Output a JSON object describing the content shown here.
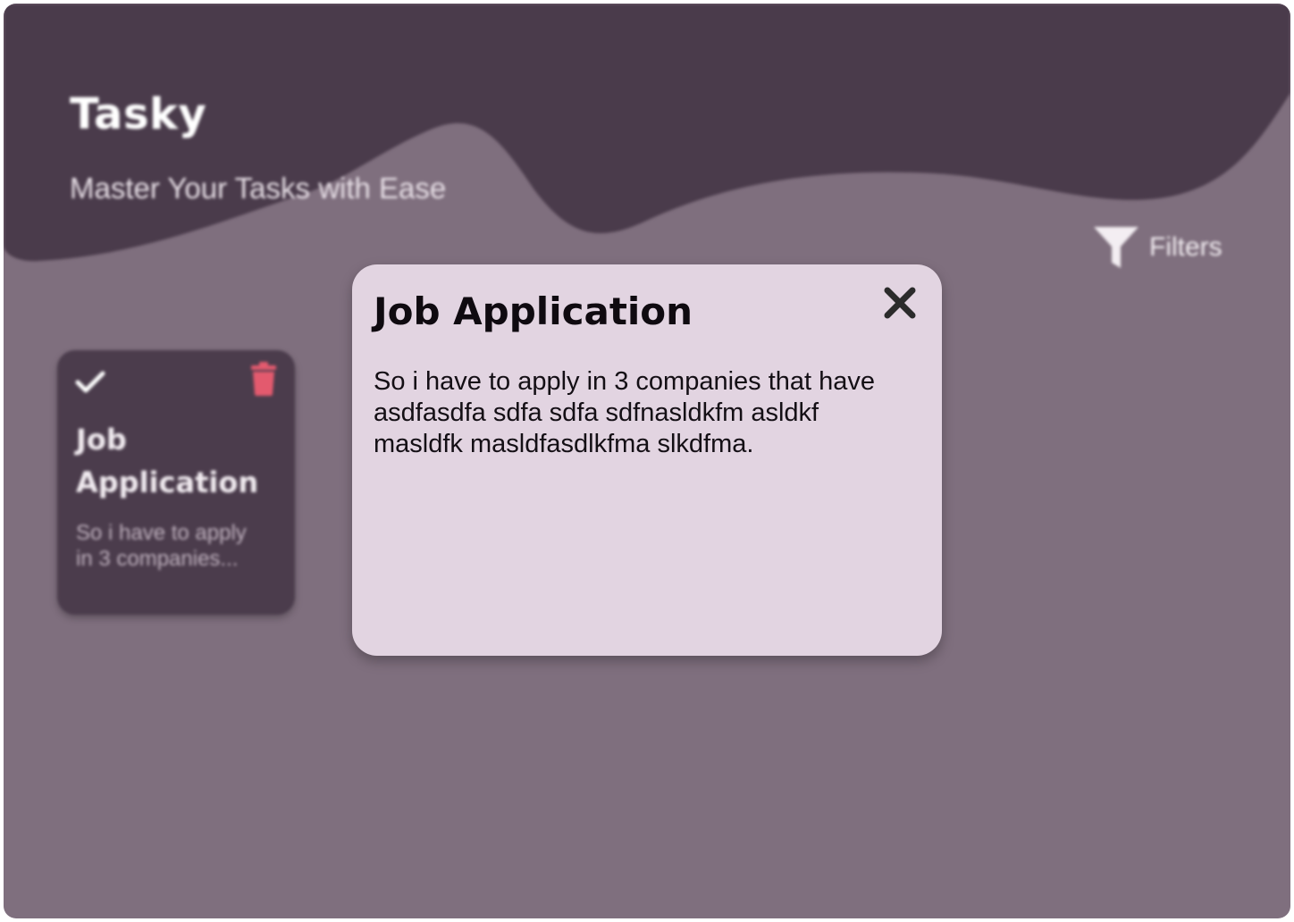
{
  "app": {
    "title": "Tasky",
    "subtitle": "Master Your Tasks with Ease"
  },
  "toolbar": {
    "filters_label": "Filters",
    "filters_icon": "filter-funnel-icon"
  },
  "tasks": [
    {
      "title": "Job Application",
      "description_preview": "So i have to apply in 3 companies...",
      "completed_icon": "check-icon",
      "delete_icon": "trash-icon"
    }
  ],
  "modal": {
    "title": "Job Application",
    "body": "So i have to apply in 3 companies that have asdfasdfa sdfa sdfa sdfnasldkfm asldkf masldfk masldfasdlkfma slkdfma.",
    "close_icon": "close-icon"
  },
  "colors": {
    "background": "#7f6f7e",
    "header_wave": "#4a3b4b",
    "card": "#4b3c4c",
    "modal": "#e2d4e1",
    "delete_accent": "#e35a6e",
    "text_light": "#ffffff",
    "text_dark": "#0f0a10"
  }
}
